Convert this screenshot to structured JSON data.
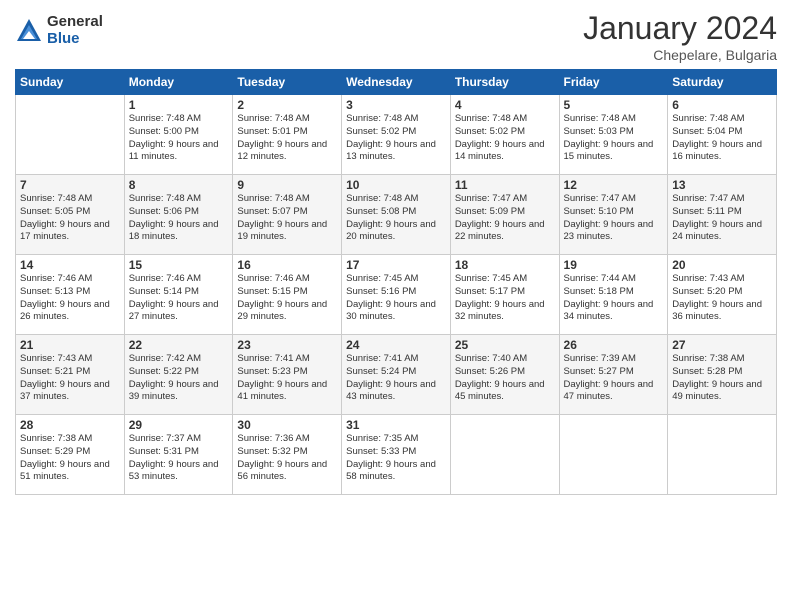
{
  "logo": {
    "general": "General",
    "blue": "Blue"
  },
  "title": "January 2024",
  "location": "Chepelare, Bulgaria",
  "days_of_week": [
    "Sunday",
    "Monday",
    "Tuesday",
    "Wednesday",
    "Thursday",
    "Friday",
    "Saturday"
  ],
  "weeks": [
    [
      {
        "day": "",
        "sunrise": "",
        "sunset": "",
        "daylight": ""
      },
      {
        "day": "1",
        "sunrise": "Sunrise: 7:48 AM",
        "sunset": "Sunset: 5:00 PM",
        "daylight": "Daylight: 9 hours and 11 minutes."
      },
      {
        "day": "2",
        "sunrise": "Sunrise: 7:48 AM",
        "sunset": "Sunset: 5:01 PM",
        "daylight": "Daylight: 9 hours and 12 minutes."
      },
      {
        "day": "3",
        "sunrise": "Sunrise: 7:48 AM",
        "sunset": "Sunset: 5:02 PM",
        "daylight": "Daylight: 9 hours and 13 minutes."
      },
      {
        "day": "4",
        "sunrise": "Sunrise: 7:48 AM",
        "sunset": "Sunset: 5:02 PM",
        "daylight": "Daylight: 9 hours and 14 minutes."
      },
      {
        "day": "5",
        "sunrise": "Sunrise: 7:48 AM",
        "sunset": "Sunset: 5:03 PM",
        "daylight": "Daylight: 9 hours and 15 minutes."
      },
      {
        "day": "6",
        "sunrise": "Sunrise: 7:48 AM",
        "sunset": "Sunset: 5:04 PM",
        "daylight": "Daylight: 9 hours and 16 minutes."
      }
    ],
    [
      {
        "day": "7",
        "sunrise": "Sunrise: 7:48 AM",
        "sunset": "Sunset: 5:05 PM",
        "daylight": "Daylight: 9 hours and 17 minutes."
      },
      {
        "day": "8",
        "sunrise": "Sunrise: 7:48 AM",
        "sunset": "Sunset: 5:06 PM",
        "daylight": "Daylight: 9 hours and 18 minutes."
      },
      {
        "day": "9",
        "sunrise": "Sunrise: 7:48 AM",
        "sunset": "Sunset: 5:07 PM",
        "daylight": "Daylight: 9 hours and 19 minutes."
      },
      {
        "day": "10",
        "sunrise": "Sunrise: 7:48 AM",
        "sunset": "Sunset: 5:08 PM",
        "daylight": "Daylight: 9 hours and 20 minutes."
      },
      {
        "day": "11",
        "sunrise": "Sunrise: 7:47 AM",
        "sunset": "Sunset: 5:09 PM",
        "daylight": "Daylight: 9 hours and 22 minutes."
      },
      {
        "day": "12",
        "sunrise": "Sunrise: 7:47 AM",
        "sunset": "Sunset: 5:10 PM",
        "daylight": "Daylight: 9 hours and 23 minutes."
      },
      {
        "day": "13",
        "sunrise": "Sunrise: 7:47 AM",
        "sunset": "Sunset: 5:11 PM",
        "daylight": "Daylight: 9 hours and 24 minutes."
      }
    ],
    [
      {
        "day": "14",
        "sunrise": "Sunrise: 7:46 AM",
        "sunset": "Sunset: 5:13 PM",
        "daylight": "Daylight: 9 hours and 26 minutes."
      },
      {
        "day": "15",
        "sunrise": "Sunrise: 7:46 AM",
        "sunset": "Sunset: 5:14 PM",
        "daylight": "Daylight: 9 hours and 27 minutes."
      },
      {
        "day": "16",
        "sunrise": "Sunrise: 7:46 AM",
        "sunset": "Sunset: 5:15 PM",
        "daylight": "Daylight: 9 hours and 29 minutes."
      },
      {
        "day": "17",
        "sunrise": "Sunrise: 7:45 AM",
        "sunset": "Sunset: 5:16 PM",
        "daylight": "Daylight: 9 hours and 30 minutes."
      },
      {
        "day": "18",
        "sunrise": "Sunrise: 7:45 AM",
        "sunset": "Sunset: 5:17 PM",
        "daylight": "Daylight: 9 hours and 32 minutes."
      },
      {
        "day": "19",
        "sunrise": "Sunrise: 7:44 AM",
        "sunset": "Sunset: 5:18 PM",
        "daylight": "Daylight: 9 hours and 34 minutes."
      },
      {
        "day": "20",
        "sunrise": "Sunrise: 7:43 AM",
        "sunset": "Sunset: 5:20 PM",
        "daylight": "Daylight: 9 hours and 36 minutes."
      }
    ],
    [
      {
        "day": "21",
        "sunrise": "Sunrise: 7:43 AM",
        "sunset": "Sunset: 5:21 PM",
        "daylight": "Daylight: 9 hours and 37 minutes."
      },
      {
        "day": "22",
        "sunrise": "Sunrise: 7:42 AM",
        "sunset": "Sunset: 5:22 PM",
        "daylight": "Daylight: 9 hours and 39 minutes."
      },
      {
        "day": "23",
        "sunrise": "Sunrise: 7:41 AM",
        "sunset": "Sunset: 5:23 PM",
        "daylight": "Daylight: 9 hours and 41 minutes."
      },
      {
        "day": "24",
        "sunrise": "Sunrise: 7:41 AM",
        "sunset": "Sunset: 5:24 PM",
        "daylight": "Daylight: 9 hours and 43 minutes."
      },
      {
        "day": "25",
        "sunrise": "Sunrise: 7:40 AM",
        "sunset": "Sunset: 5:26 PM",
        "daylight": "Daylight: 9 hours and 45 minutes."
      },
      {
        "day": "26",
        "sunrise": "Sunrise: 7:39 AM",
        "sunset": "Sunset: 5:27 PM",
        "daylight": "Daylight: 9 hours and 47 minutes."
      },
      {
        "day": "27",
        "sunrise": "Sunrise: 7:38 AM",
        "sunset": "Sunset: 5:28 PM",
        "daylight": "Daylight: 9 hours and 49 minutes."
      }
    ],
    [
      {
        "day": "28",
        "sunrise": "Sunrise: 7:38 AM",
        "sunset": "Sunset: 5:29 PM",
        "daylight": "Daylight: 9 hours and 51 minutes."
      },
      {
        "day": "29",
        "sunrise": "Sunrise: 7:37 AM",
        "sunset": "Sunset: 5:31 PM",
        "daylight": "Daylight: 9 hours and 53 minutes."
      },
      {
        "day": "30",
        "sunrise": "Sunrise: 7:36 AM",
        "sunset": "Sunset: 5:32 PM",
        "daylight": "Daylight: 9 hours and 56 minutes."
      },
      {
        "day": "31",
        "sunrise": "Sunrise: 7:35 AM",
        "sunset": "Sunset: 5:33 PM",
        "daylight": "Daylight: 9 hours and 58 minutes."
      },
      {
        "day": "",
        "sunrise": "",
        "sunset": "",
        "daylight": ""
      },
      {
        "day": "",
        "sunrise": "",
        "sunset": "",
        "daylight": ""
      },
      {
        "day": "",
        "sunrise": "",
        "sunset": "",
        "daylight": ""
      }
    ]
  ]
}
